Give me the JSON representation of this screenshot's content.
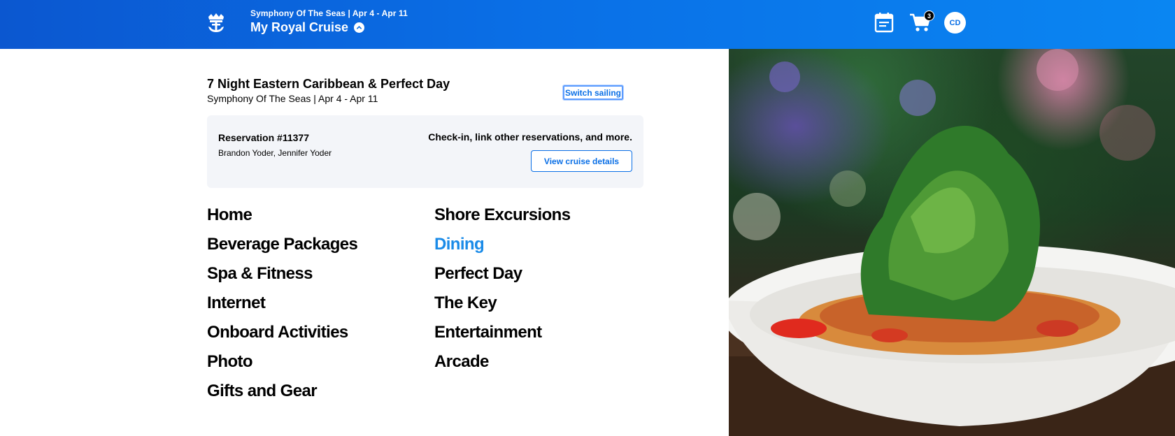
{
  "header": {
    "sailing_info": "Symphony Of The Seas | Apr 4 - Apr 11",
    "title": "My Royal Cruise",
    "cart_count": "3",
    "avatar_initials": "CD",
    "icons": [
      "crown-anchor-logo",
      "chevron-up-icon",
      "calendar-icon",
      "cart-icon"
    ]
  },
  "trip": {
    "title": "7 Night Eastern Caribbean & Perfect Day",
    "subtitle": "Symphony Of The Seas | Apr 4 - Apr 11",
    "switch_label": "Switch sailing"
  },
  "reservation": {
    "number": "Reservation #11377",
    "guests": "Brandon Yoder, Jennifer Yoder",
    "cta_text": "Check-in, link other reservations, and more.",
    "view_button": "View cruise details"
  },
  "nav": {
    "left": [
      "Home",
      "Beverage Packages",
      "Spa & Fitness",
      "Internet",
      "Onboard Activities",
      "Photo",
      "Gifts and Gear"
    ],
    "right": [
      "Shore Excursions",
      "Dining",
      "Perfect Day",
      "The Key",
      "Entertainment",
      "Arcade"
    ],
    "active": "Dining"
  },
  "colors": {
    "header_blue": "#0a6fe6",
    "active_link": "#1a8be8",
    "card_bg": "#f3f5f9"
  }
}
